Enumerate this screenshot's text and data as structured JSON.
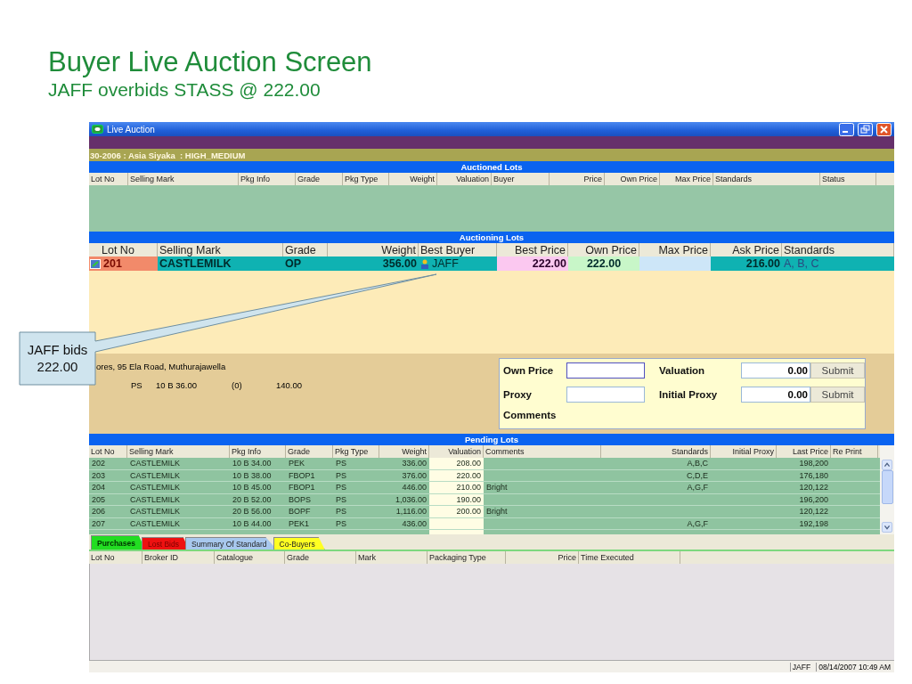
{
  "slide": {
    "title": "Buyer Live Auction Screen",
    "subtitle": "JAFF overbids STASS @ 222.00"
  },
  "window": {
    "title": "Live Auction"
  },
  "sale_info": "30-2006 : Asia Siyaka  : HIGH_MEDIUM",
  "auctioned_lots": {
    "title": "Auctioned Lots",
    "columns": [
      "Lot No",
      "Selling Mark",
      "Pkg Info",
      "Grade",
      "Pkg Type",
      "Weight",
      "Valuation",
      "Buyer",
      "Price",
      "Own Price",
      "Max Price",
      "Standards",
      "Status"
    ]
  },
  "auctioning_lots": {
    "title": "Auctioning Lots",
    "columns": [
      "Lot No",
      "Selling Mark",
      "Grade",
      "Weight",
      "Best Buyer",
      "Best Price",
      "Own Price",
      "Max Price",
      "Ask Price",
      "Standards"
    ],
    "rows": [
      {
        "lot_no": "201",
        "selling_mark": "CASTLEMILK",
        "grade": "OP",
        "weight": "356.00",
        "best_buyer": "JAFF",
        "best_price": "222.00",
        "own_price": "222.00",
        "ask_price": "216.00",
        "standards": "A, B, C"
      }
    ]
  },
  "broker_details": {
    "address": "ores, 95 Ela Road, Muthurajawella",
    "lot_line": [
      "PS",
      "10 B 36.00",
      "(0)",
      "140.00"
    ]
  },
  "bid_form": {
    "own_price": {
      "label": "Own Price"
    },
    "valuation": {
      "label": "Valuation",
      "value": "0.00",
      "button": "Submit"
    },
    "proxy": {
      "label": "Proxy"
    },
    "initial_proxy": {
      "label": "Initial Proxy",
      "value": "0.00",
      "button": "Submit"
    },
    "comments": {
      "label": "Comments"
    }
  },
  "pending_lots": {
    "title": "Pending Lots",
    "columns": [
      "Lot No",
      "Selling Mark",
      "Pkg Info",
      "Grade",
      "Pkg Type",
      "Weight",
      "Valuation",
      "Comments",
      "Standards",
      "Initial Proxy",
      "Last Price",
      "Re Print"
    ],
    "rows": [
      {
        "lot_no": "202",
        "selling_mark": "CASTLEMILK",
        "pkg_info": "10 B 34.00",
        "grade": "PEK",
        "pkg_type": "PS",
        "weight": "336.00",
        "valuation": "208.00",
        "standards": "A,B,C",
        "last_price": "198,200"
      },
      {
        "lot_no": "203",
        "selling_mark": "CASTLEMILK",
        "pkg_info": "10 B 38.00",
        "grade": "FBOP1",
        "pkg_type": "PS",
        "weight": "376.00",
        "valuation": "220.00",
        "standards": "C,D,E",
        "last_price": "176,180"
      },
      {
        "lot_no": "204",
        "selling_mark": "CASTLEMILK",
        "pkg_info": "10 B 45.00",
        "grade": "FBOP1",
        "pkg_type": "PS",
        "weight": "446.00",
        "valuation": "210.00",
        "comments": "Bright",
        "standards": "A,G,F",
        "last_price": "120,122"
      },
      {
        "lot_no": "205",
        "selling_mark": "CASTLEMILK",
        "pkg_info": "20 B 52.00",
        "grade": "BOPS",
        "pkg_type": "PS",
        "weight": "1,036.00",
        "valuation": "190.00",
        "last_price": "196,200"
      },
      {
        "lot_no": "206",
        "selling_mark": "CASTLEMILK",
        "pkg_info": "20 B 56.00",
        "grade": "BOPF",
        "pkg_type": "PS",
        "weight": "1,116.00",
        "valuation": "200.00",
        "comments": "Bright",
        "last_price": "120,122"
      },
      {
        "lot_no": "207",
        "selling_mark": "CASTLEMILK",
        "pkg_info": "10 B 44.00",
        "grade": "PEK1",
        "pkg_type": "PS",
        "weight": "436.00",
        "standards": "A,G,F",
        "last_price": "192,198"
      }
    ]
  },
  "tabs": [
    {
      "label": "Purchases",
      "selected": true,
      "color": "#22dd22"
    },
    {
      "label": "Lost Bids",
      "selected": false,
      "color": "#ee1111"
    },
    {
      "label": "Summary Of Standard",
      "selected": false,
      "color": "#a8c8ee"
    },
    {
      "label": "Co-Buyers",
      "selected": false,
      "color": "#ffff22"
    }
  ],
  "purchases": {
    "columns": [
      "Lot No",
      "Broker ID",
      "Catalogue",
      "Grade",
      "Mark",
      "Packaging Type",
      "Price",
      "Time Executed"
    ]
  },
  "status_bar": {
    "user": "JAFF",
    "datetime": "08/14/2007 10:49 AM"
  },
  "callout": {
    "text": "JAFF bids 222.00"
  }
}
